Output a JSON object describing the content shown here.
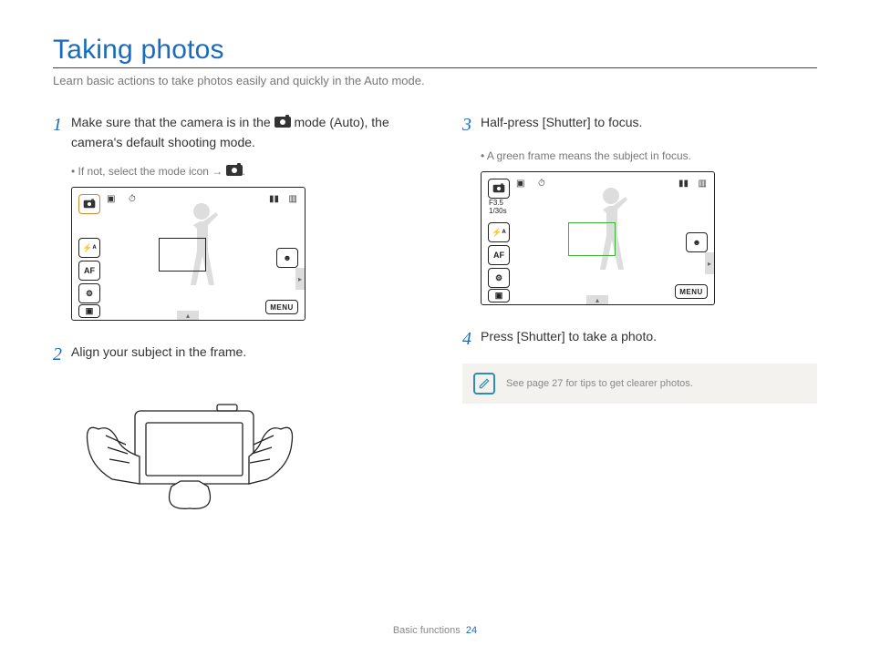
{
  "title": "Taking photos",
  "subtitle": "Learn basic actions to take photos easily and quickly in the Auto mode.",
  "steps": {
    "s1": {
      "num": "1",
      "text_a": "Make sure that the camera is in the ",
      "text_b": " mode (Auto), the camera's default shooting mode.",
      "bullet_a": "If not, select the mode icon → ",
      "bullet_b": "."
    },
    "s2": {
      "num": "2",
      "text": "Align your subject in the frame."
    },
    "s3": {
      "num": "3",
      "text_a": "Half-press [",
      "bold": "Shutter",
      "text_b": "] to focus.",
      "bullet": "A green frame means the subject in focus."
    },
    "s4": {
      "num": "4",
      "text_a": "Press [",
      "bold": "Shutter",
      "text_b": "] to take a photo."
    }
  },
  "lcd": {
    "af": "AF",
    "flash": "⚡ᴬ",
    "menu": "MENU",
    "aperture": "F3.5",
    "shutter": "1/30s"
  },
  "tip": "See page 27 for tips to get clearer photos.",
  "footer": {
    "section": "Basic functions",
    "page": "24"
  }
}
